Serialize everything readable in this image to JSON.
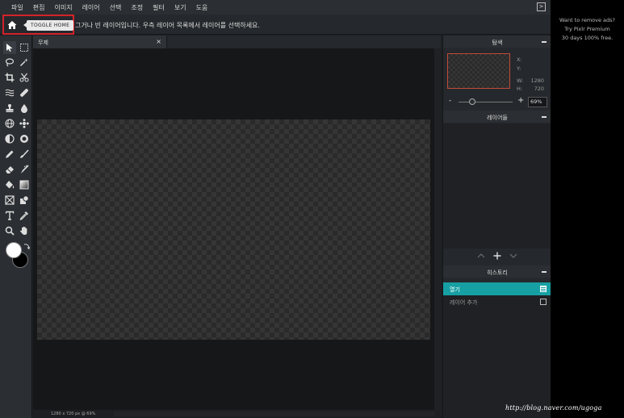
{
  "menu": {
    "items": [
      "파일",
      "편집",
      "이미지",
      "레이어",
      "선택",
      "조정",
      "필터",
      "보기",
      "도움"
    ],
    "fullscreen_icon": "fullscreen-toggle-icon"
  },
  "optbar": {
    "home_icon": "home-icon",
    "tooltip": "TOGGLE HOME",
    "hint": "그거나 빈 레이어입니다. 우측 레이어 목록에서 레이어를 선택하세요."
  },
  "tools": {
    "items": [
      "move-tool",
      "marquee-tool",
      "lasso-tool",
      "magic-wand-tool",
      "crop-tool",
      "cut-tool",
      "liquify-tool",
      "healing-tool",
      "clone-stamp-tool",
      "blur-tool",
      "spherize-tool",
      "pattern-tool",
      "dodge-tool",
      "sponge-tool",
      "pencil-tool",
      "brush-tool",
      "eraser-tool",
      "smudge-tool",
      "bucket-fill-tool",
      "gradient-tool",
      "image-placeholder-tool",
      "shape-tool",
      "text-tool",
      "color-picker-tool",
      "zoom-tool",
      "hand-tool"
    ],
    "active": "move-tool",
    "foreground_color": "#ffffff",
    "background_color": "#000000"
  },
  "document": {
    "tab_title": "무제",
    "tab_close": "×",
    "status": "1280 x 720 px @ 69%"
  },
  "navigator": {
    "title": "탐색",
    "x_label": "X:",
    "y_label": "Y:",
    "w_label": "W:",
    "h_label": "H:",
    "w_value": "1280",
    "h_value": "720",
    "zoom_minus": "-",
    "zoom_plus": "+",
    "zoom_value": "69%"
  },
  "layers": {
    "title": "레이어들",
    "actions": [
      "^",
      "+",
      "v"
    ]
  },
  "history": {
    "title": "히스토리",
    "items": [
      {
        "label": "열기",
        "selected": true
      },
      {
        "label": "레이어 추가",
        "selected": false
      }
    ]
  },
  "ad": {
    "line1": "Want to remove ads?",
    "line2": "Try Pixlr Premium",
    "line3": "30 days 100% free."
  },
  "watermark": "http://blog.naver.com/ugoga",
  "colors": {
    "accent": "#17a0a4",
    "highlight_box": "#d2232a",
    "navigator_frame": "#c24a3a"
  }
}
